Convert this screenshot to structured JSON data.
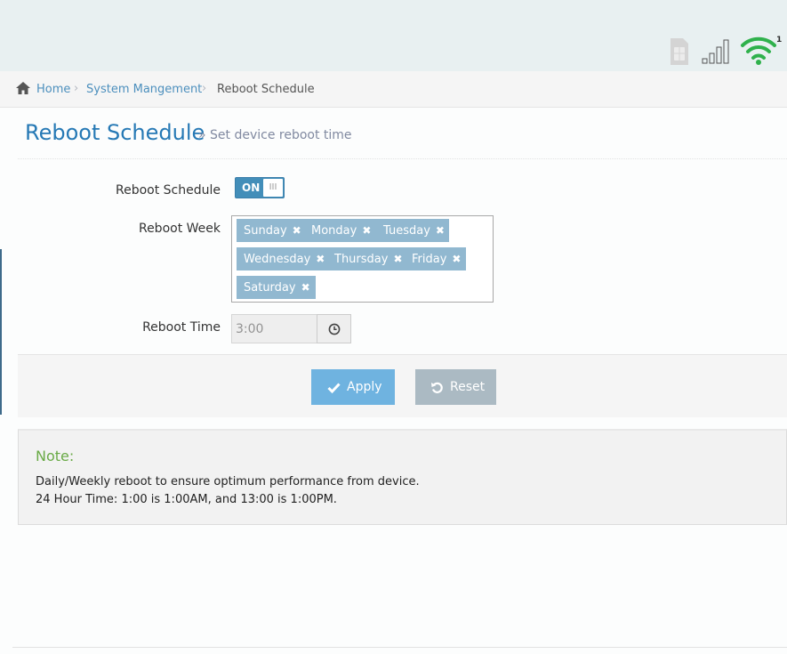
{
  "status": {
    "wifi_count": "1",
    "colors": {
      "wifi": "#2fb14c",
      "signal": "#555555",
      "sim": "#c9c9c9"
    }
  },
  "breadcrumb": {
    "home": "Home",
    "section": "System Mangement",
    "current": "Reboot Schedule"
  },
  "page": {
    "title": "Reboot Schedule",
    "subtitle": "Set device reboot time"
  },
  "form": {
    "schedule_label": "Reboot Schedule",
    "toggle_on": "ON",
    "toggle_knob": "III",
    "week_label": "Reboot Week",
    "days": [
      "Sunday",
      "Monday",
      "Tuesday",
      "Wednesday",
      "Thursday",
      "Friday",
      "Saturday"
    ],
    "time_label": "Reboot Time",
    "time_value": "3:00"
  },
  "actions": {
    "apply": "Apply",
    "reset": "Reset"
  },
  "note": {
    "title": "Note:",
    "line1": "Daily/Weekly reboot to ensure optimum performance from device.",
    "line2": "24 Hour Time: 1:00 is 1:00AM, and 13:00 is 1:00PM."
  }
}
